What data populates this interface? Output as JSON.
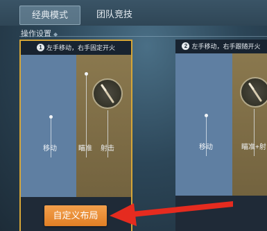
{
  "tabs": [
    {
      "label": "经典模式",
      "active": true
    },
    {
      "label": "团队竞技",
      "active": false
    }
  ],
  "section_label": "操作设置",
  "cards": [
    {
      "number": "1",
      "title": "左手移动，右手固定开火",
      "move_label": "移动",
      "aim_label": "瞄准",
      "fire_label": "射击",
      "selected": true
    },
    {
      "number": "2",
      "title": "左手移动，右手跟随开火",
      "move_label": "移动",
      "aimfire_label": "瞄准+射",
      "selected": false
    }
  ],
  "custom_button_label": "自定义布局",
  "colors": {
    "accent_border": "#d6a637",
    "button": "#e8902f",
    "arrow": "#e52b1f"
  },
  "icons": [
    "bullet-icon",
    "red-arrow-annotation"
  ]
}
